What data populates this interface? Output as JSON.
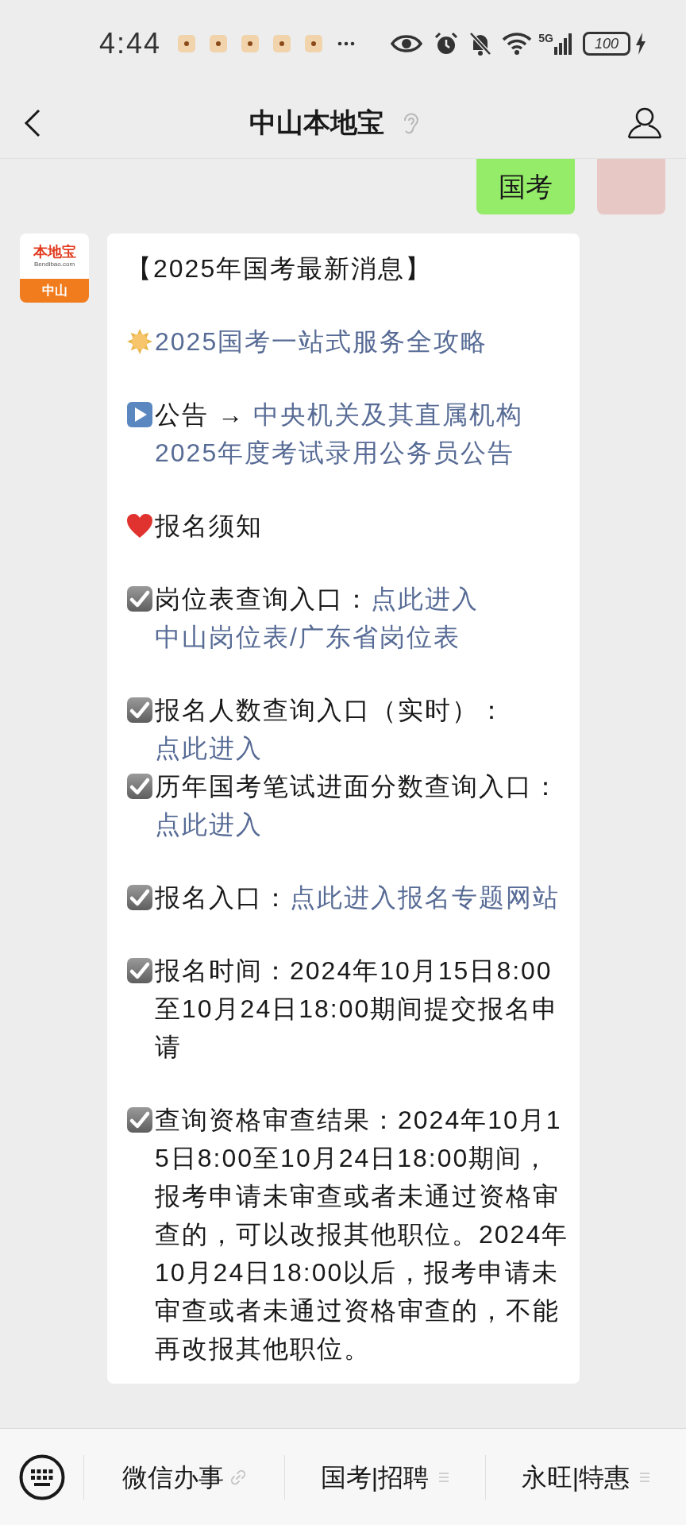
{
  "status_bar": {
    "time": "4:44",
    "notifications": [
      {
        "kind": "app"
      },
      {
        "kind": "app"
      },
      {
        "kind": "app"
      },
      {
        "kind": "app"
      },
      {
        "kind": "app"
      }
    ],
    "network": "5G",
    "battery": "100",
    "charging": true
  },
  "header": {
    "title": "中山本地宝"
  },
  "chat": {
    "user_message": {
      "text": "国考"
    },
    "bot_avatar": {
      "brand": "本地宝",
      "site": "Bendibao.com",
      "city": "中山"
    },
    "bot_message": {
      "blocks": [
        [
          {
            "kind": "plain",
            "segments": [
              {
                "text": "【2025年国考最新消息】",
                "link": false
              }
            ]
          }
        ],
        [
          {
            "kind": "sun",
            "segments": [
              {
                "text": "2025国考一站式服务全攻略",
                "link": true
              }
            ]
          }
        ],
        [
          {
            "kind": "play",
            "segments": [
              {
                "text": "公告 → ",
                "link": false
              },
              {
                "text": "中央机关及其直属机构",
                "link": true
              },
              {
                "text": "2025年度考试录用公务员公告",
                "link": true
              }
            ]
          }
        ],
        [
          {
            "kind": "heart",
            "segments": [
              {
                "text": "报名须知",
                "link": false
              }
            ]
          }
        ],
        [
          {
            "kind": "check",
            "segments": [
              {
                "text": "岗位表查询入口：",
                "link": false
              },
              {
                "text": "点此进入",
                "link": true
              },
              {
                "text": "中山岗位表/广东省岗位表",
                "link": true
              }
            ]
          }
        ],
        [
          {
            "kind": "check",
            "segments": [
              {
                "text": "报名人数查询入口（实时）：",
                "link": false
              },
              {
                "text": "点此进入",
                "link": true
              }
            ]
          },
          {
            "kind": "check",
            "segments": [
              {
                "text": "历年国考笔试进面分数查询入口：",
                "link": false
              },
              {
                "text": "点此进入",
                "link": true
              }
            ]
          }
        ],
        [
          {
            "kind": "check",
            "segments": [
              {
                "text": "报名入口：",
                "link": false
              },
              {
                "text": "点此进入报名专题网站",
                "link": true
              }
            ]
          }
        ],
        [
          {
            "kind": "check",
            "segments": [
              {
                "text": "报名时间：2024年10月15日8:00至10月24日18:00期间提交报名申请",
                "link": false
              }
            ]
          }
        ],
        [
          {
            "kind": "check",
            "segments": [
              {
                "text": "查询资格审查结果：2024年10月15日8:00至10月24日18:00期间，报考申请未审查或者未通过资格审查的，可以改报其他职位。2024年10月24日18:00以后，报考申请未审查或者未通过资格审查的，不能再改报其他职位。",
                "link": false
              }
            ]
          }
        ]
      ]
    }
  },
  "bottom_menu": [
    {
      "label": "微信办事",
      "kind": "link"
    },
    {
      "label": "国考|招聘",
      "kind": "menu"
    },
    {
      "label": "永旺|特惠",
      "kind": "menu"
    }
  ]
}
